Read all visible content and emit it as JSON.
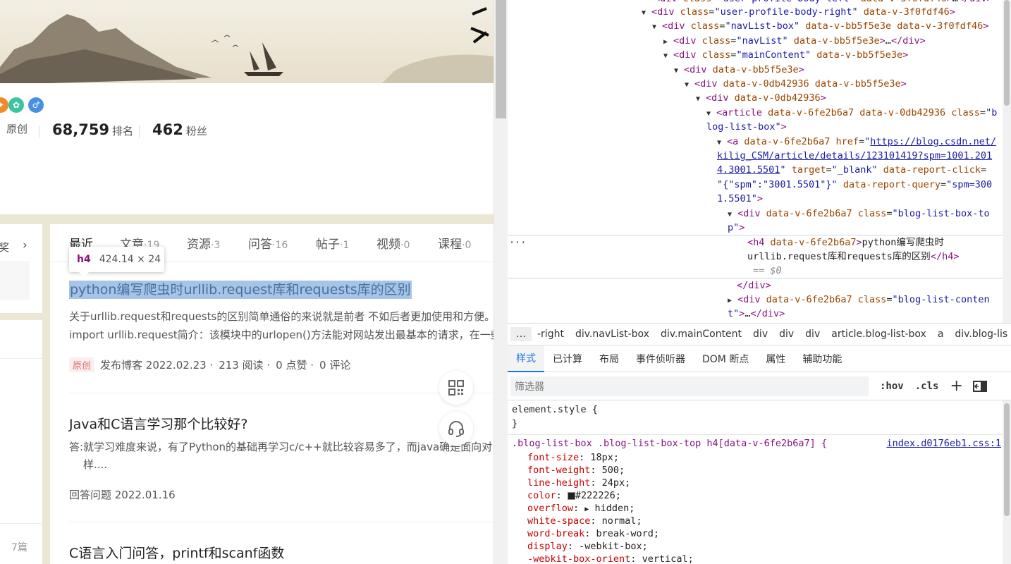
{
  "profile": {
    "stats": [
      {
        "num": "",
        "label": "原创"
      },
      {
        "num": "68,759",
        "label": "排名"
      },
      {
        "num": "462",
        "label": "粉丝"
      }
    ]
  },
  "left_column": {
    "first_label": "奖",
    "bottom_label": "7篇"
  },
  "tabs": [
    {
      "label": "最近",
      "count": ""
    },
    {
      "label": "文章",
      "count": "·19"
    },
    {
      "label": "资源",
      "count": "·3"
    },
    {
      "label": "问答",
      "count": "·16"
    },
    {
      "label": "帖子",
      "count": "·1"
    },
    {
      "label": "视频",
      "count": "·0"
    },
    {
      "label": "课程",
      "count": "·0"
    }
  ],
  "inspect_tooltip": {
    "tag": "h4",
    "size": "424.14 × 24"
  },
  "articles": [
    {
      "title": "python编写爬虫时urllib.request库和requests库的区别",
      "line1": "关于urllib.request和requests的区别简单通俗的来说就是前者 不如后者更加使用和方便。",
      "line2": "import urllib.request简介：该模块中的urlopen()方法能对网站发出最基本的请求，在一些",
      "badge": "原创",
      "meta": [
        "发布博客 2022.02.23 ·",
        "213 阅读 ·",
        "0 点赞 ·",
        "0 评论"
      ]
    },
    {
      "title": "Java和C语言学习那个比较好?",
      "line1": "答:就学习难度来说，有了Python的基础再学习c/c++就比较容易多了，而java确是面向对",
      "line2": "样....",
      "meta": [
        "回答问题 2022.01.16"
      ]
    },
    {
      "title": "C语言入门问答，printf和scanf函数"
    }
  ],
  "devtools": {
    "dom_lines": [
      {
        "indent": 0,
        "html": "<span class='tg'>&lt;div</span> <span class='an'>class</span>=<span class='av'>\"user-profile-body-left\"</span> <span class='an'>data-v-3f0fdf46</span><span class='tg'>&gt;</span>…<span class='tg'>&lt;/div&gt;</span>"
      },
      {
        "indent": 0,
        "html": "<span class='tri'>▼</span><span class='tg'>&lt;div</span> <span class='an'>class</span>=<span class='av'>\"user-profile-body-right\"</span> <span class='an'>data-v-3f0fdf46</span><span class='tg'>&gt;</span>"
      },
      {
        "indent": 1,
        "html": "<span class='tri'>▼</span><span class='tg'>&lt;div</span> <span class='an'>class</span>=<span class='av'>\"navList-box\"</span> <span class='an'>data-v-bb5f5e3e data-v-3f0fdf46</span><span class='tg'>&gt;</span>"
      }
    ],
    "selected_h4_text_1": "python编写爬虫时",
    "selected_h4_text_2": "urllib.request库和requests库的区别",
    "eq": "== $0",
    "breadcrumbs": [
      "-right",
      "div.navList-box",
      "div.mainContent",
      "div",
      "div",
      "div",
      "article.blog-list-box",
      "a",
      "div.blog-lis"
    ],
    "panel_tabs": [
      "样式",
      "已计算",
      "布局",
      "事件侦听器",
      "DOM 断点",
      "属性",
      "辅助功能"
    ],
    "filter_placeholder": "筛选器",
    "filter_buttons": [
      ":hov",
      ".cls"
    ],
    "element_style": "element.style {",
    "rule_selector": ".blog-list-box .blog-list-box-top h4[data-v-6fe2b6a7] {",
    "rule_source": "index.d0176eb1.css:1",
    "props": [
      {
        "name": "font-size",
        "value": "18px;"
      },
      {
        "name": "font-weight",
        "value": "500;"
      },
      {
        "name": "line-height",
        "value": "24px;"
      },
      {
        "name": "color",
        "value": "#222226;"
      },
      {
        "name": "overflow",
        "value": "hidden;"
      },
      {
        "name": "white-space",
        "value": "normal;"
      },
      {
        "name": "word-break",
        "value": "break-word;"
      },
      {
        "name": "display",
        "value": "-webkit-box;"
      },
      {
        "name": "-webkit-box-orient",
        "value": "vertical;"
      }
    ]
  }
}
